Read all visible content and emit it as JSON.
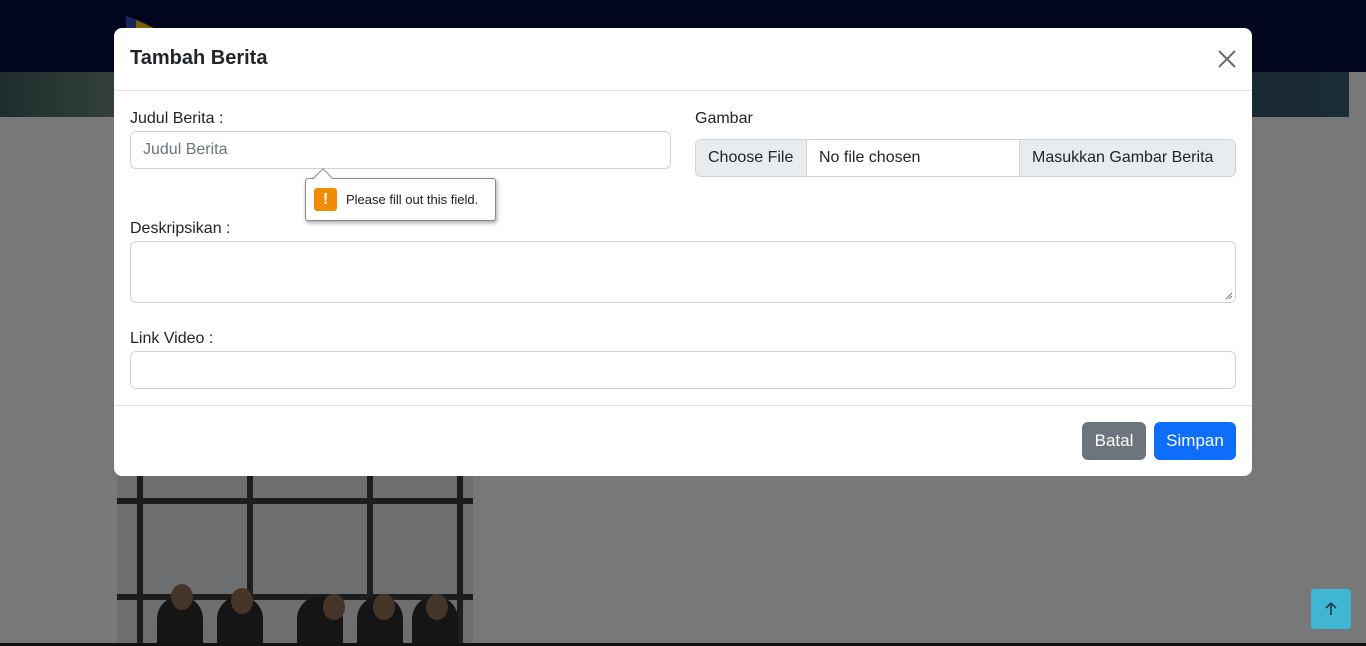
{
  "modal": {
    "title": "Tambah Berita",
    "close_icon": "close-icon",
    "fields": {
      "title_label": "Judul Berita :",
      "title_placeholder": "Judul Berita",
      "image_label": "Gambar",
      "file_button": "Choose File",
      "file_status": "No file chosen",
      "file_addon": "Masukkan Gambar Berita",
      "description_label": "Deskripsikan :",
      "video_label": "Link Video :"
    },
    "validation": {
      "icon": "warning-icon",
      "message": "Please fill out this field."
    },
    "footer": {
      "cancel_label": "Batal",
      "save_label": "Simpan"
    }
  },
  "page": {
    "scroll_top_icon": "arrow-up-icon"
  },
  "colors": {
    "navbar": "#020a3a",
    "primary": "#0d6efd",
    "secondary": "#6c757d",
    "scroll_top": "#3fb6d3",
    "warning": "#f08c00"
  }
}
